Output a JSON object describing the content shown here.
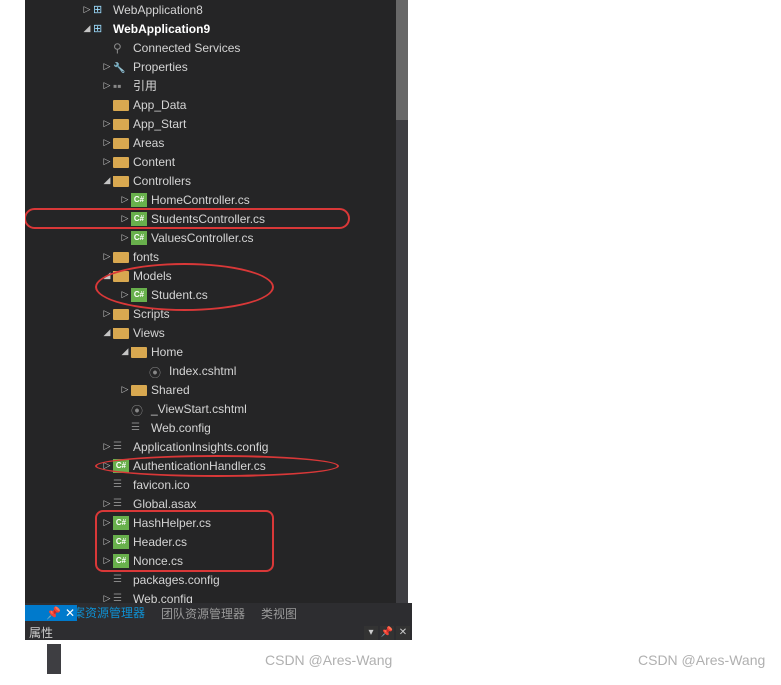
{
  "tree": {
    "webapp8": "WebApplication8",
    "webapp9": "WebApplication9",
    "connected": "Connected Services",
    "properties": "Properties",
    "refs": "引用",
    "appdata": "App_Data",
    "appstart": "App_Start",
    "areas": "Areas",
    "content": "Content",
    "controllers": "Controllers",
    "homectrl": "HomeController.cs",
    "studentsctrl": "StudentsController.cs",
    "valuesctrl": "ValuesController.cs",
    "fonts": "fonts",
    "models": "Models",
    "student": "Student.cs",
    "scripts": "Scripts",
    "views": "Views",
    "home": "Home",
    "index": "Index.cshtml",
    "shared": "Shared",
    "viewstart": "_ViewStart.cshtml",
    "webconfig1": "Web.config",
    "appinsights": "ApplicationInsights.config",
    "authhandler": "AuthenticationHandler.cs",
    "favicon": "favicon.ico",
    "global": "Global.asax",
    "hashhelper": "HashHelper.cs",
    "header": "Header.cs",
    "nonce": "Nonce.cs",
    "packages": "packages.config",
    "webconfig2": "Web.config"
  },
  "tabs": {
    "solution": "解决方案资源管理器",
    "team": "团队资源管理器",
    "classview": "类视图"
  },
  "prop": "属性",
  "watermark": "CSDN @Ares-Wang"
}
